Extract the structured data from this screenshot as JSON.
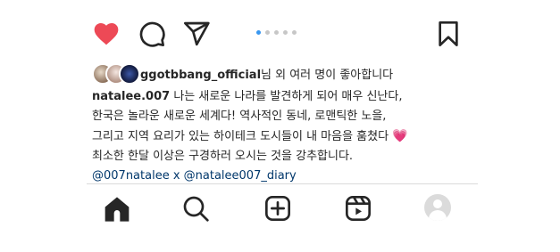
{
  "post": {
    "actions": {
      "like_icon": "heart-filled-icon",
      "comment_icon": "comment-icon",
      "share_icon": "send-icon",
      "save_icon": "bookmark-icon",
      "liked": true,
      "like_color": "#ed4956"
    },
    "carousel": {
      "count": 5,
      "active_index": 0,
      "active_color": "#3897f0"
    },
    "likes": {
      "user": "ggotbbang_official",
      "suffix": "님 외 여러 명이 좋아합니다"
    },
    "caption": {
      "username": "natalee.007",
      "line1": " 나는 새로운 나라를 발견하게 되어 매우 신난다,",
      "line2": "한국은 놀라운 새로운 세계다! 역사적인 동네, 로맨틱한 노을,",
      "line3": "그리고 지역 요리가 있는 하이테크 도시들이 내 마음을 훔쳤다 ",
      "heart": "💗",
      "line4": "최소한 한달 이상은 구경하러 오시는 것을 강추합니다.",
      "mentions": "@007natalee x @natalee007_diary"
    }
  },
  "tabbar": {
    "items": [
      "home-icon",
      "search-icon",
      "new-post-icon",
      "reels-icon",
      "profile-avatar"
    ]
  }
}
